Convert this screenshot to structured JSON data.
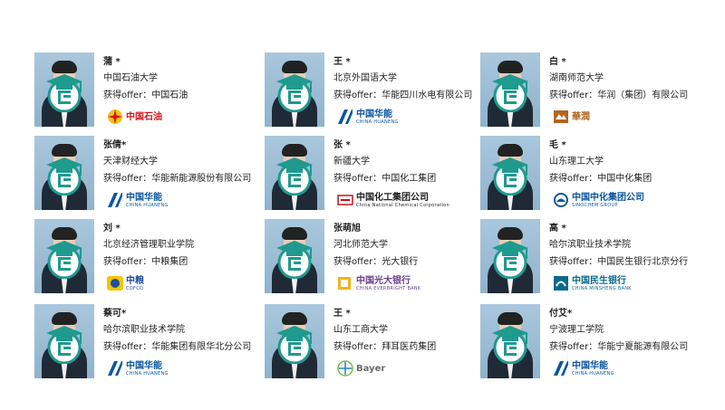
{
  "cards": [
    {
      "name": "蒲 *",
      "school": "中国石油大学",
      "offer": "获得offer：中国石油",
      "logo": {
        "cn": "中国石油",
        "en": "",
        "color": "#d4161b",
        "kind": "petro-icon"
      }
    },
    {
      "name": "王 *",
      "school": "北京外国语大学",
      "offer": "获得offer：华能四川水电有限公司",
      "logo": {
        "cn": "中国华能",
        "en": "CHINA HUANENG",
        "color": "#0a56a0",
        "kind": "huaneng-icon"
      }
    },
    {
      "name": "白 *",
      "school": "湖南师范大学",
      "offer": "获得offer：华润（集团）有限公司",
      "logo": {
        "cn": "華潤",
        "en": "",
        "color": "#b4651f",
        "kind": "huarun-icon"
      }
    },
    {
      "name": "张倩*",
      "school": "天津财经大学",
      "offer": "获得offer：华能新能源股份有限公司",
      "logo": {
        "cn": "中国华能",
        "en": "CHINA HUANENG",
        "color": "#0a56a0",
        "kind": "huaneng-icon"
      }
    },
    {
      "name": "张 *",
      "school": "新疆大学",
      "offer": "获得offer：中国化工集团",
      "logo": {
        "cn": "中国化工集团公司",
        "en": "China National Chemical Corporation",
        "color": "#222222",
        "kind": "chemchina-icon"
      }
    },
    {
      "name": "毛 *",
      "school": "山东理工大学",
      "offer": "获得offer：中国中化集团",
      "logo": {
        "cn": "中国中化集团公司",
        "en": "SINOCHEM GROUP",
        "color": "#0a56a0",
        "kind": "sinochem-icon"
      }
    },
    {
      "name": "刘 *",
      "school": "北京经济管理职业学院",
      "offer": "获得offer：中粮集团",
      "logo": {
        "cn": "中粮",
        "en": "COFCO",
        "color": "#1d4fa0",
        "kind": "cofco-icon"
      }
    },
    {
      "name": "张萌旭",
      "school": "河北师范大学",
      "offer": "获得offer：光大银行",
      "logo": {
        "cn": "中国光大银行",
        "en": "CHINA EVERBRIGHT BANK",
        "color": "#6a3f8c",
        "kind": "everbright-icon"
      }
    },
    {
      "name": "高 *",
      "school": "哈尔滨职业技术学院",
      "offer": "获得offer：中国民生银行北京分行",
      "logo": {
        "cn": "中国民生银行",
        "en": "CHINA MINSHENG BANK",
        "color": "#0a6a8c",
        "kind": "minsheng-icon"
      }
    },
    {
      "name": "蔡可*",
      "school": "哈尔滨职业技术学院",
      "offer": "获得offer：华能集团有限华北分公司",
      "logo": {
        "cn": "中国华能",
        "en": "CHINA HUANENG",
        "color": "#0a56a0",
        "kind": "huaneng-icon"
      }
    },
    {
      "name": "王 *",
      "school": "山东工商大学",
      "offer": "获得offer：拜耳医药集团",
      "logo": {
        "cn": "Bayer",
        "en": "",
        "color": "#6b6b6b",
        "kind": "bayer-icon"
      }
    },
    {
      "name": "付艾*",
      "school": "宁波理工学院",
      "offer": "获得offer：华能宁夏能源有限公司",
      "logo": {
        "cn": "中国华能",
        "en": "CHINA HUANENG",
        "color": "#0a56a0",
        "kind": "huaneng-icon"
      }
    }
  ],
  "colors": {
    "badge_teal": "#1f9a8e",
    "text": "#222222"
  }
}
